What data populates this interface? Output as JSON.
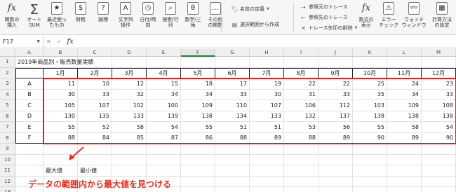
{
  "ribbon": {
    "buttons": [
      {
        "label": "関数の\n挿入",
        "icon": "fx-icon",
        "glyph": "fx"
      },
      {
        "label": "オート\nSUM",
        "icon": "sum-icon",
        "glyph": "∑"
      },
      {
        "label": "最近使っ\nたもの",
        "icon": "recent-icon",
        "glyph": "★"
      },
      {
        "label": "財務",
        "icon": "finance-icon",
        "glyph": "$"
      },
      {
        "label": "論理",
        "icon": "logical-icon",
        "glyph": "?"
      },
      {
        "label": "文字列\n操作",
        "icon": "text-icon",
        "glyph": "A"
      },
      {
        "label": "日付/時刻",
        "icon": "datetime-icon",
        "glyph": "◷"
      },
      {
        "label": "検索/行列",
        "icon": "lookup-icon",
        "glyph": "⌕"
      },
      {
        "label": "数学/三角",
        "icon": "math-icon",
        "glyph": "θ"
      },
      {
        "label": "その他\nの関数",
        "icon": "more-functions-icon",
        "glyph": "…"
      }
    ],
    "names": {
      "define": "名前の定義",
      "create": "選択範囲から作成"
    },
    "audit": {
      "precedents": "参照元のトレース",
      "dependents": "参照先のトレース",
      "remove": "トレース矢印の削除"
    },
    "right_buttons": [
      {
        "label": "数式の\n表示",
        "icon": "show-formulas-icon",
        "glyph": "fx"
      },
      {
        "label": "エラー\nチェック",
        "icon": "error-check-icon",
        "glyph": "⚠"
      },
      {
        "label": "ウォッチ\nウィンドウ",
        "icon": "watch-window-icon",
        "glyph": "👓"
      },
      {
        "label": "計算方法\nの設定",
        "icon": "calc-options-icon",
        "glyph": "▦"
      }
    ]
  },
  "formula_bar": {
    "name_box": "F17",
    "fx": "fx",
    "formula": ""
  },
  "sheet": {
    "columns": [
      "A",
      "B",
      "C",
      "D",
      "E",
      "F",
      "G",
      "H",
      "I",
      "J",
      "K",
      "L",
      "M"
    ],
    "selected_column": "F",
    "rows": [
      "1",
      "2",
      "3",
      "4",
      "5",
      "6",
      "7",
      "8",
      "9",
      "10",
      "11",
      "12",
      "13"
    ],
    "title": "2019年商品別・販売数量実績",
    "months": [
      "1月",
      "2月",
      "3月",
      "4月",
      "5月",
      "6月",
      "7月",
      "8月",
      "9月",
      "10月",
      "11月",
      "12月"
    ],
    "data": [
      {
        "product": "A",
        "values": [
          11,
          10,
          12,
          15,
          18,
          17,
          19,
          22,
          22,
          25,
          24,
          23
        ]
      },
      {
        "product": "B",
        "values": [
          30,
          33,
          32,
          34,
          34,
          33,
          30,
          31,
          33,
          35,
          34,
          33
        ]
      },
      {
        "product": "C",
        "values": [
          105,
          107,
          102,
          100,
          109,
          110,
          107,
          106,
          112,
          103,
          109,
          108
        ]
      },
      {
        "product": "D",
        "values": [
          130,
          135,
          133,
          139,
          138,
          134,
          133,
          132,
          137,
          138,
          138,
          138
        ]
      },
      {
        "product": "E",
        "values": [
          55,
          52,
          58,
          54,
          55,
          51,
          51,
          53,
          56,
          55,
          58,
          54
        ]
      },
      {
        "product": "F",
        "values": [
          88,
          84,
          85,
          87,
          86,
          88,
          89,
          88,
          89,
          90,
          89,
          90
        ]
      }
    ],
    "max_label": "最大値",
    "min_label": "最小値"
  },
  "annotation": {
    "text": "データの範囲内から最大値を見つける",
    "color": "#e53020"
  }
}
